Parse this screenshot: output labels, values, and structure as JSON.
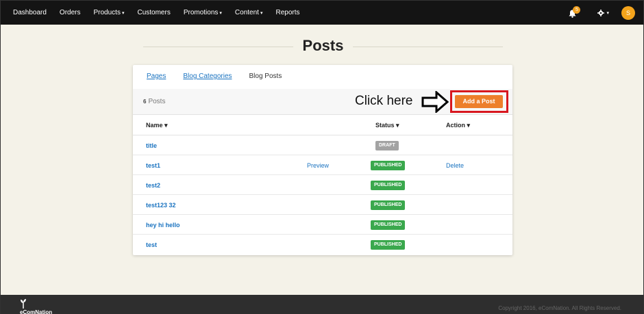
{
  "nav": {
    "items": [
      {
        "label": "Dashboard",
        "caret": ""
      },
      {
        "label": "Orders",
        "caret": ""
      },
      {
        "label": "Products",
        "caret": "▾"
      },
      {
        "label": "Customers",
        "caret": ""
      },
      {
        "label": "Promotions",
        "caret": "▾"
      },
      {
        "label": "Content",
        "caret": "▾"
      },
      {
        "label": "Reports",
        "caret": ""
      }
    ],
    "notification_count": "5",
    "avatar_initial": "S"
  },
  "page": {
    "title": "Posts"
  },
  "tabs": [
    {
      "label": "Pages",
      "active": false
    },
    {
      "label": "Blog Categories",
      "active": false
    },
    {
      "label": "Blog Posts",
      "active": true
    }
  ],
  "toolbar": {
    "count_number": "6",
    "count_label": "Posts",
    "annotation": "Click here",
    "add_button": "Add a Post"
  },
  "table": {
    "headers": {
      "name": "Name ▾",
      "status": "Status ▾",
      "action": "Action ▾"
    },
    "rows": [
      {
        "name": "title",
        "preview": "",
        "status": "DRAFT",
        "status_kind": "draft",
        "action": ""
      },
      {
        "name": "test1",
        "preview": "Preview",
        "status": "PUBLISHED",
        "status_kind": "published",
        "action": "Delete"
      },
      {
        "name": "test2",
        "preview": "",
        "status": "PUBLISHED",
        "status_kind": "published",
        "action": ""
      },
      {
        "name": "test123 32",
        "preview": "",
        "status": "PUBLISHED",
        "status_kind": "published",
        "action": ""
      },
      {
        "name": "hey hi hello",
        "preview": "",
        "status": "PUBLISHED",
        "status_kind": "published",
        "action": ""
      },
      {
        "name": "test",
        "preview": "",
        "status": "PUBLISHED",
        "status_kind": "published",
        "action": ""
      }
    ]
  },
  "footer": {
    "logo": "eComNation",
    "copyright": "Copyright 2016, eComNation. All Rights Reserved."
  },
  "colors": {
    "accent": "#ed7f2b",
    "link": "#1a73c0",
    "published": "#3aa84d",
    "draft": "#a3a3a3",
    "highlight": "#d8171f"
  }
}
